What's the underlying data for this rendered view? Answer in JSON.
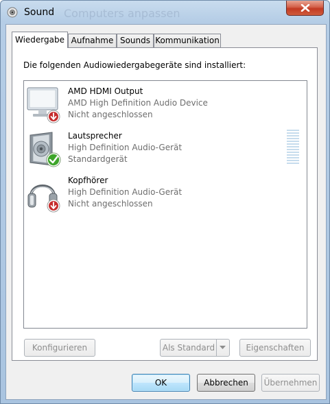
{
  "window": {
    "title": "Sound",
    "ghost_title": "Computers anpassen"
  },
  "tabs": [
    {
      "label": "Wiedergabe",
      "active": true
    },
    {
      "label": "Aufnahme",
      "active": false
    },
    {
      "label": "Sounds",
      "active": false
    },
    {
      "label": "Kommunikation",
      "active": false
    }
  ],
  "panel": {
    "heading": "Die folgenden Audiowiedergabegeräte sind installiert:"
  },
  "devices": [
    {
      "name": "AMD HDMI Output",
      "description": "AMD High Definition Audio Device",
      "status": "Nicht angeschlossen",
      "icon": "monitor-icon",
      "badge": "disconnected-arrow-icon"
    },
    {
      "name": "Lautsprecher",
      "description": "High Definition Audio-Gerät",
      "status": "Standardgerät",
      "icon": "speaker-icon",
      "badge": "default-checkmark-icon"
    },
    {
      "name": "Kopfhörer",
      "description": "High Definition Audio-Gerät",
      "status": "Nicht angeschlossen",
      "icon": "headphones-icon",
      "badge": "disconnected-arrow-icon"
    }
  ],
  "panel_buttons": {
    "configure": "Konfigurieren",
    "set_default": "Als Standard",
    "properties": "Eigenschaften"
  },
  "dialog_buttons": {
    "ok": "OK",
    "cancel": "Abbrechen",
    "apply": "Übernehmen"
  },
  "colors": {
    "accent_green": "#3ea52a",
    "disconnected_red": "#c62e2e",
    "level_meter": "#c6dced"
  }
}
